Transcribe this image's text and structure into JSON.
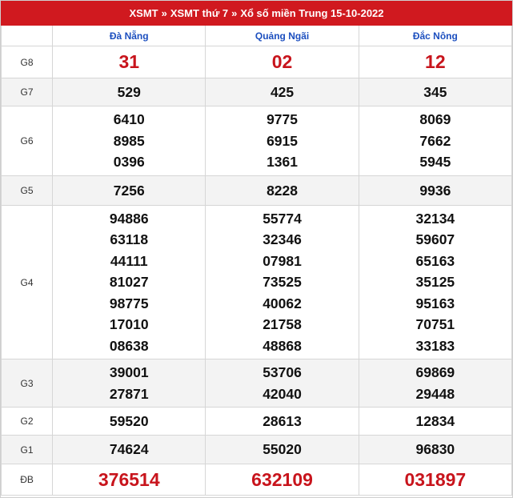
{
  "breadcrumb": {
    "items": [
      "XSMT",
      "XSMT thứ 7",
      "Xổ số miền Trung 15-10-2022"
    ],
    "separator": "»"
  },
  "provinces": [
    "Đà Nẵng",
    "Quảng Ngãi",
    "Đắc Nông"
  ],
  "prizes": [
    {
      "label": "G8",
      "values": [
        [
          "31"
        ],
        [
          "02"
        ],
        [
          "12"
        ]
      ]
    },
    {
      "label": "G7",
      "values": [
        [
          "529"
        ],
        [
          "425"
        ],
        [
          "345"
        ]
      ]
    },
    {
      "label": "G6",
      "values": [
        [
          "6410",
          "8985",
          "0396"
        ],
        [
          "9775",
          "6915",
          "1361"
        ],
        [
          "8069",
          "7662",
          "5945"
        ]
      ]
    },
    {
      "label": "G5",
      "values": [
        [
          "7256"
        ],
        [
          "8228"
        ],
        [
          "9936"
        ]
      ]
    },
    {
      "label": "G4",
      "values": [
        [
          "94886",
          "63118",
          "44111",
          "81027",
          "98775",
          "17010",
          "08638"
        ],
        [
          "55774",
          "32346",
          "07981",
          "73525",
          "40062",
          "21758",
          "48868"
        ],
        [
          "32134",
          "59607",
          "65163",
          "35125",
          "95163",
          "70751",
          "33183"
        ]
      ]
    },
    {
      "label": "G3",
      "values": [
        [
          "39001",
          "27871"
        ],
        [
          "53706",
          "42040"
        ],
        [
          "69869",
          "29448"
        ]
      ]
    },
    {
      "label": "G2",
      "values": [
        [
          "59520"
        ],
        [
          "28613"
        ],
        [
          "12834"
        ]
      ]
    },
    {
      "label": "G1",
      "values": [
        [
          "74624"
        ],
        [
          "55020"
        ],
        [
          "96830"
        ]
      ]
    },
    {
      "label": "ĐB",
      "values": [
        [
          "376514"
        ],
        [
          "632109"
        ],
        [
          "031897"
        ]
      ]
    }
  ],
  "colors": {
    "header_bg": "#d0191f",
    "province_text": "#1c4fbf",
    "highlight_number": "#c8141c",
    "shaded_row": "#f3f3f3"
  }
}
